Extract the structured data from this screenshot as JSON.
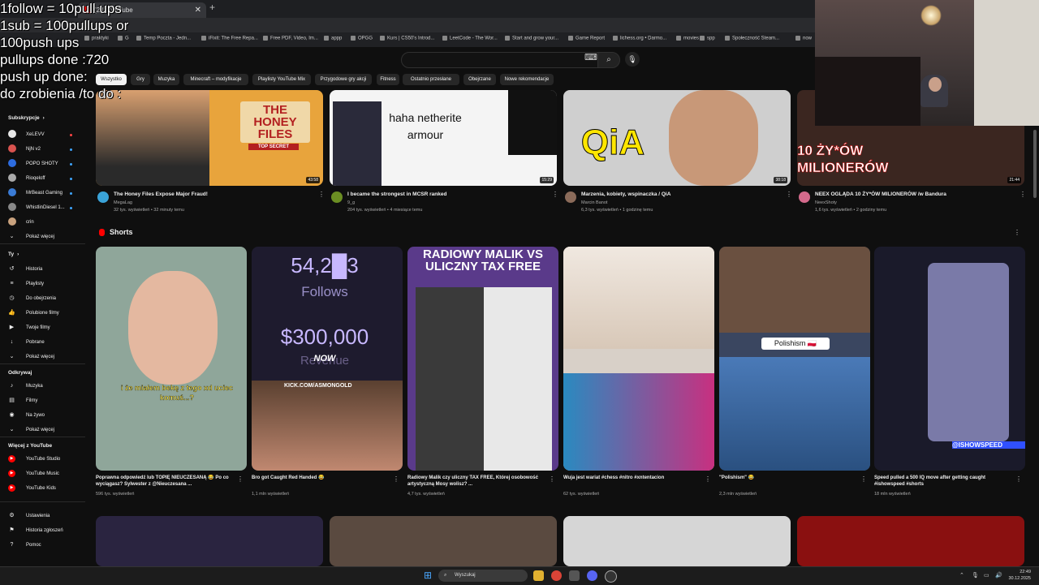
{
  "overlay": {
    "lines": [
      "1follow = 10pull ups",
      "1sub = 100pullups or",
      "100push ups",
      "pullups done :720",
      "push up done:",
      "do zrobienia /to do :"
    ]
  },
  "browser": {
    "tab_label": "(23) YouTube",
    "bookmarks": [
      "praktyki",
      "G",
      "Temp Poczta - Jedn...",
      "iFixit: The Free Repa...",
      "Free PDF, Video, Im...",
      "appp",
      "OPGG",
      "Kurs | CS50's Introd...",
      "LeetCode - The Wor...",
      "Start and grow your...",
      "Game Report",
      "lichess.org • Darmo...",
      "movies",
      "spp",
      "Społeczność Steam...",
      "now"
    ]
  },
  "search": {
    "placeholder": ""
  },
  "chips": [
    "Wszystko",
    "Gry",
    "Muzyka",
    "Minecraft – modyfikacje",
    "Playlisty YouTube Mix",
    "Przygodowe gry akcji",
    "Fitness",
    "Ostatnio przesłane",
    "Obejrzane",
    "Nowe rekomendacje"
  ],
  "sidebar": {
    "subs_header": "Subskrypcje",
    "subs": [
      {
        "label": "XeLEVV",
        "color": "#e8e8e8"
      },
      {
        "label": "NjN v2",
        "color": "#d9534f"
      },
      {
        "label": "POPO SHOTY",
        "color": "#2d6cdf"
      },
      {
        "label": "Rioqeloff",
        "color": "#aaaaaa"
      },
      {
        "label": "MrBeast Gaming",
        "color": "#3a7bd5"
      },
      {
        "label": "WhistlinDiesel 1...",
        "color": "#888888"
      },
      {
        "label": "crin",
        "color": "#c9a27e"
      }
    ],
    "show_more": "Pokaż więcej",
    "you_header": "Ty",
    "you_items": [
      {
        "label": "Historia",
        "icon": "history-icon",
        "glyph": "↺"
      },
      {
        "label": "Playlisty",
        "icon": "playlist-icon",
        "glyph": "≡"
      },
      {
        "label": "Do obejrzenia",
        "icon": "clock-icon",
        "glyph": "◷"
      },
      {
        "label": "Polubione filmy",
        "icon": "like-icon",
        "glyph": "👍"
      },
      {
        "label": "Twoje filmy",
        "icon": "video-icon",
        "glyph": "▶"
      },
      {
        "label": "Pobrane",
        "icon": "download-icon",
        "glyph": "↓"
      }
    ],
    "explore_header": "Odkrywaj",
    "explore_items": [
      {
        "label": "Muzyka",
        "icon": "music-icon",
        "glyph": "♪"
      },
      {
        "label": "Filmy",
        "icon": "film-icon",
        "glyph": "▤"
      },
      {
        "label": "Na żywo",
        "icon": "live-icon",
        "glyph": "◉"
      }
    ],
    "more_header": "Więcej z YouTube",
    "more_items": [
      "YouTube Studio",
      "YouTube Music",
      "YouTube Kids"
    ],
    "settings_items": [
      {
        "label": "Ustawienia",
        "icon": "gear-icon",
        "glyph": "⚙"
      },
      {
        "label": "Historia zgłoszeń",
        "icon": "flag-icon",
        "glyph": "⚑"
      },
      {
        "label": "Pomoc",
        "icon": "help-icon",
        "glyph": "?"
      }
    ]
  },
  "videos": [
    {
      "title": "The Honey Files Expose Major Fraud!",
      "channel": "MegaLag",
      "meta": "32 tys. wyświetleń • 32 minuty temu",
      "duration": "43:58",
      "bg": "#e8a43c",
      "avatar": "#3aa3d8"
    },
    {
      "title": "I became the strongest in MCSR ranked",
      "channel": "9_g",
      "meta": "204 tys. wyświetleń • 4 miesiące temu",
      "duration": "15:29",
      "bg": "#f4f4f4",
      "avatar": "#6b8e23"
    },
    {
      "title": "Marzenia, kobiety, wspinaczka / QiA",
      "channel": "Marcin Banot",
      "meta": "6,3 tys. wyświetleń • 1 godzinę temu",
      "duration": "38:18",
      "bg": "#cfcfcf",
      "avatar": "#8b6b5a"
    },
    {
      "title": "NEEX OGLĄDA 10 ŻY*ÓW MILIONERÓW /w Bandura",
      "channel": "NeexShoty",
      "meta": "1,6 tys. wyświetleń • 2 godziny temu",
      "duration": "21:44",
      "bg": "#3b2620",
      "avatar": "#d46a8c"
    }
  ],
  "thumb_texts": {
    "honey": "THE HONEY FILES",
    "honey_sub": "TOP SECRET",
    "netherite": "haha netherite armour",
    "qia": "QiA",
    "zydow": "10 ŻY*ÓW MILIONERÓW"
  },
  "shorts_label": "Shorts",
  "shorts": [
    {
      "title": "Poprawna odpowiedź lub TOPIĘ NIEUCZESANĄ 😂 Po co wyciągasz? Sylwester z @Nieuczesana ...",
      "meta": "596 tys. wyświetleń",
      "bg": "#8fa69a",
      "caption": "i że miałem bekę z tego xd uciec komuś...?"
    },
    {
      "title": "Bro got Caught Red Handed 😂",
      "meta": "1,1 mln wyświetleń",
      "bg": "#1e1b2e",
      "caption": ""
    },
    {
      "title": "Radiowy Malik czy uliczny TAX FREE, Której osobowość artystyczną Mosy wolisz? ...",
      "meta": "4,7 tys. wyświetleń",
      "bg": "#5a3a8a",
      "caption": "RADIOWY MALIK VS ULICZNY TAX FREE"
    },
    {
      "title": "Wuja jest wariat #chess #nitro #xntentacion",
      "meta": "62 tys. wyświetleń",
      "bg": "#d8d0c8",
      "caption": ""
    },
    {
      "title": "\"Polishism\" 😂",
      "meta": "2,3 mln wyświetleń",
      "bg": "#3a4660",
      "caption": "Polishism 🇵🇱"
    },
    {
      "title": "Speed pulled a 500 IQ move after getting caught #ishowspeed #shorts",
      "meta": "18 mln wyświetleń",
      "bg": "#1a1a2a",
      "caption": "@ISHOWSPEED"
    }
  ],
  "follow_text": {
    "count": "54,2█3",
    "label": "Follows",
    "revenue": "$300,000",
    "rev_label": "Revenue",
    "now": "NOW",
    "kick": "KICK.COM/ASMONGOLD"
  },
  "taskbar": {
    "search": "Wyszukaj",
    "time": "22:49",
    "date": "30.12.2025"
  }
}
